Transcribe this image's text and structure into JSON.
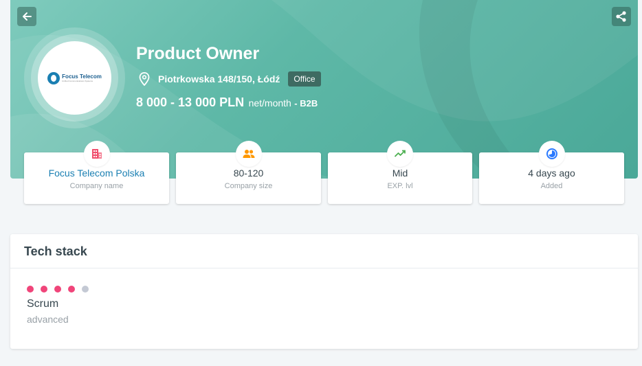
{
  "job": {
    "title": "Product Owner",
    "address": "Piotrkowska 148/150, Łódź",
    "workplace_badge": "Office",
    "salary_amount": "8 000 - 13 000 PLN",
    "salary_unit": "net/month",
    "contract": "- B2B"
  },
  "company_logo": {
    "name": "Focus Telecom",
    "tagline": "Unified Communications Systems"
  },
  "cards": [
    {
      "value": "Focus Telecom Polska",
      "label": "Company name",
      "icon": "building-icon",
      "icon_color": "#f0506e"
    },
    {
      "value": "80-120",
      "label": "Company size",
      "icon": "users-icon",
      "icon_color": "#ff9800"
    },
    {
      "value": "Mid",
      "label": "EXP. lvl",
      "icon": "trending-up-icon",
      "icon_color": "#4caf50"
    },
    {
      "value": "4 days ago",
      "label": "Added",
      "icon": "clock-icon",
      "icon_color": "#2979ff"
    }
  ],
  "tech_stack": {
    "heading": "Tech stack",
    "skills": [
      {
        "name": "Scrum",
        "level": "advanced",
        "rating": 4,
        "max": 5
      }
    ]
  },
  "colors": {
    "hero": "#5eb8a7",
    "dot_active": "#f0457a",
    "dot_inactive": "#c4c9d4",
    "link": "#1a7fb2"
  }
}
